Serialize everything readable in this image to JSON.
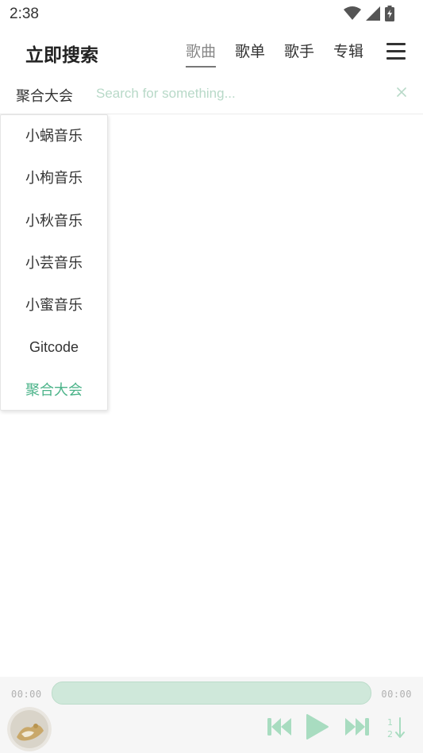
{
  "status_bar": {
    "time": "2:38"
  },
  "header": {
    "title": "立即搜索",
    "tabs": [
      {
        "label": "歌曲",
        "active": true
      },
      {
        "label": "歌单",
        "active": false
      },
      {
        "label": "歌手",
        "active": false
      },
      {
        "label": "专辑",
        "active": false
      }
    ],
    "menu_icon": "hamburger-menu-icon"
  },
  "search": {
    "source_label": "聚合大会",
    "placeholder": "Search for something...",
    "value": "",
    "clear_icon": "close-icon"
  },
  "source_dropdown": {
    "items": [
      {
        "label": "小蜗音乐",
        "selected": false
      },
      {
        "label": "小枸音乐",
        "selected": false
      },
      {
        "label": "小秋音乐",
        "selected": false
      },
      {
        "label": "小芸音乐",
        "selected": false
      },
      {
        "label": "小蜜音乐",
        "selected": false
      },
      {
        "label": "Gitcode",
        "selected": false
      },
      {
        "label": "聚合大会",
        "selected": true
      }
    ]
  },
  "player": {
    "time_current": "00:00",
    "time_total": "00:00",
    "progress": 0,
    "icons": [
      "cover-art",
      "previous-icon",
      "play-icon",
      "next-icon",
      "play-order-icon"
    ]
  },
  "colors": {
    "accent": "#4bb389",
    "placeholder": "#b8d9c8",
    "progress_track": "#cfe8da",
    "control_icon": "#a8dcc0"
  }
}
